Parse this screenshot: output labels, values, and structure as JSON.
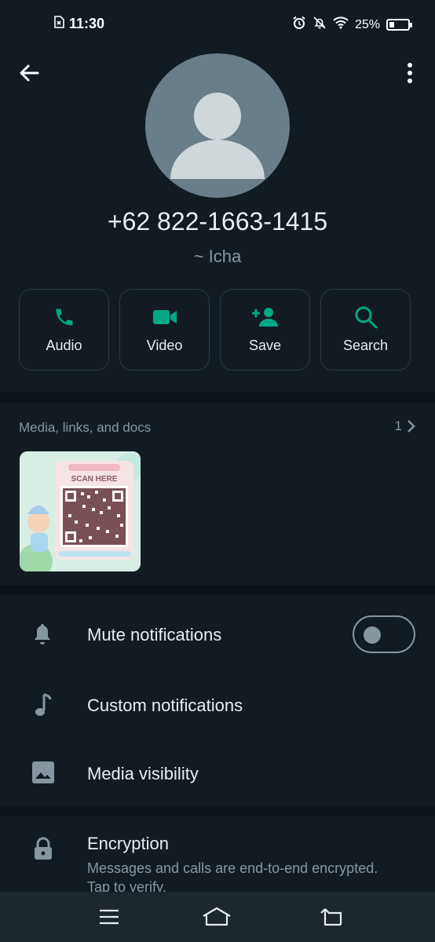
{
  "status_bar": {
    "time": "11:30",
    "battery_text": "25%",
    "battery_level": 0.25
  },
  "contact": {
    "phone": "+62 822-1663-1415",
    "push_name": "~ Icha"
  },
  "actions": [
    {
      "label": "Audio",
      "icon": "phone-icon"
    },
    {
      "label": "Video",
      "icon": "video-icon"
    },
    {
      "label": "Save",
      "icon": "add-person-icon"
    },
    {
      "label": "Search",
      "icon": "search-icon"
    }
  ],
  "media": {
    "title": "Media, links, and docs",
    "count": "1",
    "thumbnail_caption": "SCAN HERE"
  },
  "settings": {
    "mute": "Mute notifications",
    "mute_enabled": false,
    "custom": "Custom notifications",
    "visibility": "Media visibility"
  },
  "encryption": {
    "title": "Encryption",
    "description": "Messages and calls are end-to-end encrypted. Tap to verify."
  },
  "colors": {
    "background": "#121b22",
    "accent": "#00a884",
    "secondary_text": "#8696a0"
  }
}
